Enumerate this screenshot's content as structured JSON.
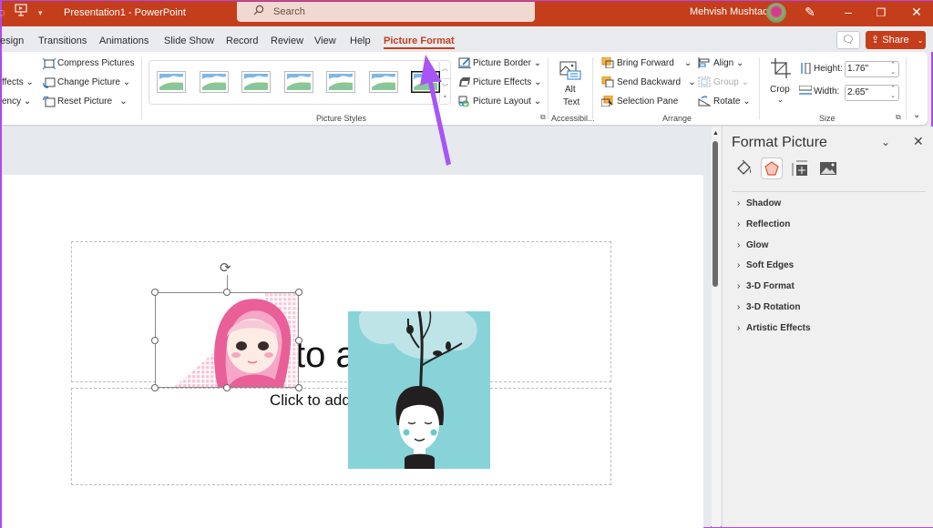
{
  "titlebar": {
    "app_title": "Presentation1  -  PowerPoint",
    "search_placeholder": "Search",
    "user_name": "Mehvish Mushtaq",
    "icons": [
      "autosave-icon",
      "present-icon",
      "customize-qat-icon",
      "pen-icon",
      "minimize-icon",
      "restore-icon",
      "close-icon"
    ],
    "brand_color": "#c43e1c"
  },
  "ribbon_tabs": {
    "tabs": [
      "esign",
      "Transitions",
      "Animations",
      "Slide Show",
      "Record",
      "Review",
      "View",
      "Help",
      "Picture Format"
    ],
    "active": "Picture Format",
    "share_label": "Share"
  },
  "ribbon": {
    "adjust": {
      "effects_label": "ffects",
      "transparency_label": "ency",
      "compress_label": "Compress Pictures",
      "change_label": "Change Picture",
      "reset_label": "Reset Picture"
    },
    "picture_styles": {
      "group_label": "Picture Styles",
      "border_label": "Picture Border",
      "effects_label": "Picture Effects",
      "layout_label": "Picture Layout",
      "style_count": 7
    },
    "accessibility": {
      "alt_text_line1": "Alt",
      "alt_text_line2": "Text",
      "group_label": "Accessibil..."
    },
    "arrange": {
      "bring_forward": "Bring Forward",
      "send_backward": "Send Backward",
      "selection_pane": "Selection Pane",
      "align": "Align",
      "group": "Group",
      "rotate": "Rotate",
      "group_label": "Arrange"
    },
    "size": {
      "crop_label": "Crop",
      "height_label": "Height:",
      "height_value": "1.76\"",
      "width_label": "Width:",
      "width_value": "2.65\"",
      "group_label": "Size"
    }
  },
  "slide": {
    "title_partial": "to a",
    "subtitle_partial": "Click to add"
  },
  "format_pane": {
    "title": "Format Picture",
    "tabs": [
      "fill-line-icon",
      "effects-icon",
      "size-properties-icon",
      "picture-icon"
    ],
    "active_tab": "effects-icon",
    "sections": [
      "Shadow",
      "Reflection",
      "Glow",
      "Soft Edges",
      "3-D Format",
      "3-D Rotation",
      "Artistic Effects"
    ]
  },
  "annotation": {
    "arrow_color": "#a855f7"
  }
}
